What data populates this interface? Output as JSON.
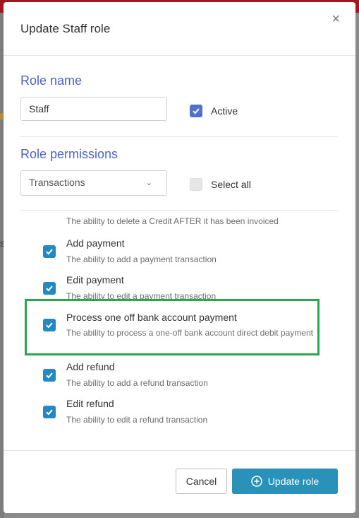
{
  "dialog": {
    "title": "Update Staff role",
    "close_glyph": "×"
  },
  "role_name": {
    "heading": "Role name",
    "value": "Staff",
    "active_label": "Active",
    "active_checked": true
  },
  "permissions": {
    "heading": "Role permissions",
    "category_selected": "Transactions",
    "select_all_label": "Select all",
    "select_all_checked": false,
    "partial_item_desc": "The ability to delete a Credit AFTER it has been invoiced",
    "items": [
      {
        "title": "Add payment",
        "desc": "The ability to add a payment transaction",
        "checked": true
      },
      {
        "title": "Edit payment",
        "desc": "The ability to edit a payment transaction",
        "checked": true
      },
      {
        "title": "Process one off bank account payment",
        "desc": "The ability to process a one-off bank account direct debit payment",
        "checked": true
      },
      {
        "title": "Add refund",
        "desc": "The ability to add a refund transaction",
        "checked": true
      },
      {
        "title": "Edit refund",
        "desc": "The ability to edit a refund transaction",
        "checked": true
      }
    ]
  },
  "footer": {
    "cancel_label": "Cancel",
    "update_label": "Update role"
  },
  "colors": {
    "accent": "#5163c2",
    "checkbox_blue": "#5470cd",
    "checkbox_teal": "#2389c2",
    "primary_button": "#2a92b8",
    "highlight": "#2ca64a"
  },
  "background": {
    "partial_letter": "s"
  }
}
